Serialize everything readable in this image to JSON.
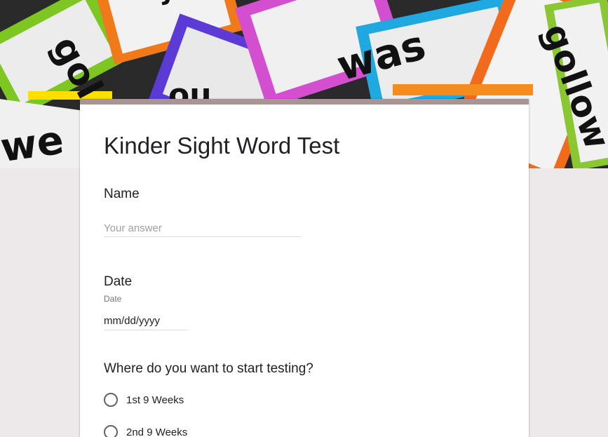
{
  "header": {
    "image_name": "sight-word-collage",
    "words": [
      "gol",
      "was",
      "gollow",
      "we",
      "ou",
      "yellow"
    ]
  },
  "form": {
    "title": "Kinder Sight Word Test",
    "accent_color": "#a89395",
    "questions": [
      {
        "title": "Name",
        "placeholder": "Your answer"
      },
      {
        "title": "Date",
        "subtitle": "Date",
        "value": "mm/dd/yyyy"
      },
      {
        "title": "Where do you want to start testing?",
        "options": [
          "1st 9 Weeks",
          "2nd 9 Weeks"
        ]
      }
    ]
  }
}
